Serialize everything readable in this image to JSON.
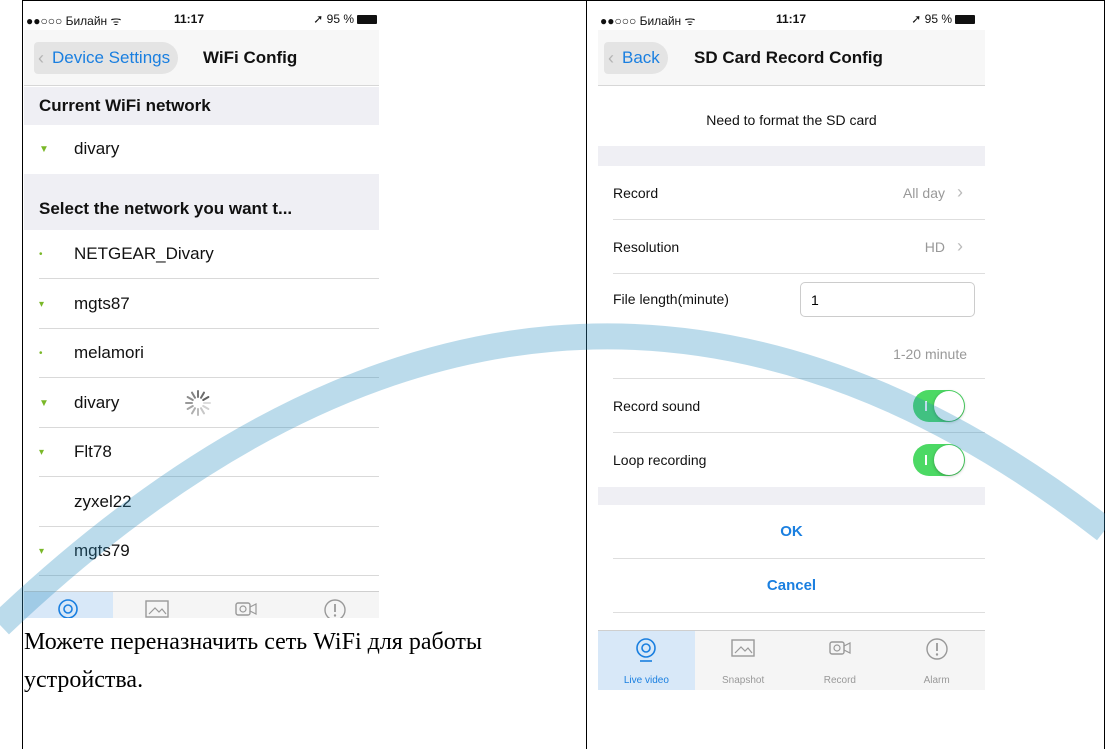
{
  "left_screen": {
    "status": {
      "carrier": "●●○○○ Билайн ᯤ",
      "time": "11:17",
      "battery": "➚ 95 %"
    },
    "nav": {
      "back_label": "Device Settings",
      "title": "WiFi Config"
    },
    "current_header": "Current WiFi network",
    "current_network": "divary",
    "select_header": "Select the network you want t...",
    "networks": [
      {
        "name": "NETGEAR_Divary",
        "signal": "weak"
      },
      {
        "name": "mgts87",
        "signal": "medium"
      },
      {
        "name": "melamori",
        "signal": "weak"
      },
      {
        "name": "divary",
        "signal": "strong"
      },
      {
        "name": "Flt78",
        "signal": "medium"
      },
      {
        "name": "zyxel22",
        "signal": "none"
      },
      {
        "name": "mgts79",
        "signal": "medium"
      }
    ]
  },
  "right_screen": {
    "status": {
      "carrier": "●●○○○ Билайн ᯤ",
      "time": "11:17",
      "battery": "➚ 95 %"
    },
    "nav": {
      "back_label": "Back",
      "title": "SD Card Record Config"
    },
    "notice": "Need to format the SD card",
    "record": {
      "label": "Record",
      "value": "All day"
    },
    "resolution": {
      "label": "Resolution",
      "value": "HD"
    },
    "file_length": {
      "label": "File length(minute)",
      "value": "1",
      "hint": "1-20 minute"
    },
    "record_sound": {
      "label": "Record sound",
      "on": true
    },
    "loop_recording": {
      "label": "Loop recording",
      "on": true
    },
    "ok_label": "OK",
    "cancel_label": "Cancel"
  },
  "tabbar": {
    "tabs": [
      {
        "label": "Live video",
        "icon": "live-video-icon"
      },
      {
        "label": "Snapshot",
        "icon": "snapshot-icon"
      },
      {
        "label": "Record",
        "icon": "record-icon"
      },
      {
        "label": "Alarm",
        "icon": "alarm-icon"
      }
    ],
    "active_color": "#1a7fe0"
  },
  "caption": "Можете переназначить сеть WiFi для работы устройства.",
  "colors": {
    "accent": "#1a7fe0",
    "toggle_on": "#4cd964",
    "wifi_signal": "#7ab829",
    "watermark": "#2a8fc0"
  }
}
